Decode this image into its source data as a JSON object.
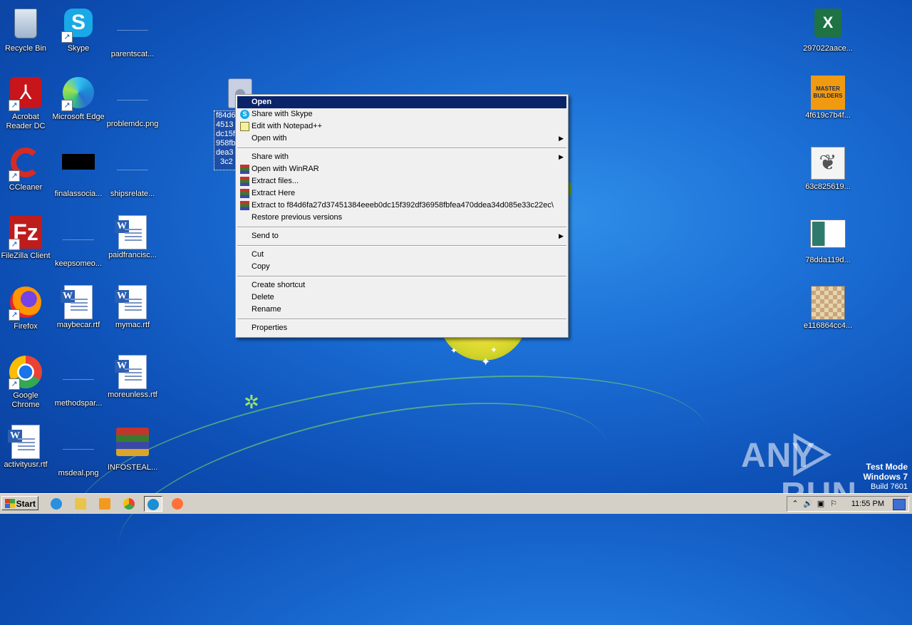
{
  "desktop": {
    "icons_left": [
      {
        "label": "Recycle Bin",
        "icon": "recycle-bin-icon",
        "shortcut": false
      },
      {
        "label": "Skype",
        "icon": "skype-icon",
        "shortcut": true
      },
      {
        "label": "parentscat...",
        "icon": "blank-file-icon",
        "shortcut": false
      },
      {
        "label": "Acrobat Reader DC",
        "icon": "acrobat-icon",
        "shortcut": true
      },
      {
        "label": "Microsoft Edge",
        "icon": "edge-icon",
        "shortcut": true
      },
      {
        "label": "problemdc.png",
        "icon": "blank-file-icon",
        "shortcut": false
      },
      {
        "label": "CCleaner",
        "icon": "ccleaner-icon",
        "shortcut": true
      },
      {
        "label": "finalassocia...",
        "icon": "black-file-icon",
        "shortcut": false
      },
      {
        "label": "shipsrelate...",
        "icon": "blank-file-icon",
        "shortcut": false
      },
      {
        "label": "FileZilla Client",
        "icon": "filezilla-icon",
        "shortcut": true
      },
      {
        "label": "keepsomeo...",
        "icon": "blank-file-icon",
        "shortcut": false
      },
      {
        "label": "paidfrancisc...",
        "icon": "word-doc-icon",
        "shortcut": false
      },
      {
        "label": "Firefox",
        "icon": "firefox-icon",
        "shortcut": true
      },
      {
        "label": "maybecar.rtf",
        "icon": "word-doc-icon",
        "shortcut": false
      },
      {
        "label": "mymac.rtf",
        "icon": "word-doc-icon",
        "shortcut": false
      },
      {
        "label": "Google Chrome",
        "icon": "chrome-icon",
        "shortcut": true
      },
      {
        "label": "methodspar...",
        "icon": "blank-file-icon",
        "shortcut": false
      },
      {
        "label": "moreunless.rtf",
        "icon": "word-doc-icon",
        "shortcut": false
      },
      {
        "label": "activityusr.rtf",
        "icon": "word-doc-icon",
        "shortcut": false
      },
      {
        "label": "msdeal.png",
        "icon": "blank-file-icon",
        "shortcut": false
      },
      {
        "label": "INFOSTEAL...",
        "icon": "winrar-icon",
        "shortcut": false
      }
    ],
    "icons_right": [
      {
        "label": "297022aace...",
        "icon": "excel-icon"
      },
      {
        "label": "4f619c7b4f...",
        "icon": "master-builders-icon"
      },
      {
        "label": "63c825619...",
        "icon": "gimp-icon"
      },
      {
        "label": "78dda119d...",
        "icon": "image-file-icon"
      },
      {
        "label": "e116864cc4...",
        "icon": "photo-file-icon"
      }
    ],
    "selected_file_lines": [
      "f84d6",
      "4513",
      "dc15f",
      "958fb",
      "dea3",
      "3c2"
    ],
    "master_builders_text": "MASTER BUILDERS"
  },
  "context_menu": {
    "items": [
      {
        "label": "Open",
        "highlight": true
      },
      {
        "label": "Share with Skype",
        "icon": "skype-icon"
      },
      {
        "label": "Edit with Notepad++",
        "icon": "notepad-plus-icon"
      },
      {
        "label": "Open with",
        "submenu": true
      },
      {
        "separator": true
      },
      {
        "label": "Share with",
        "submenu": true
      },
      {
        "label": "Open with WinRAR",
        "icon": "winrar-icon"
      },
      {
        "label": "Extract files...",
        "icon": "winrar-icon"
      },
      {
        "label": "Extract Here",
        "icon": "winrar-icon"
      },
      {
        "label": "Extract to f84d6fa27d37451384eeeb0dc15f392df36958fbfea470ddea34d085e33c22ec\\",
        "icon": "winrar-icon"
      },
      {
        "label": "Restore previous versions"
      },
      {
        "separator": true
      },
      {
        "label": "Send to",
        "submenu": true
      },
      {
        "separator": true
      },
      {
        "label": "Cut"
      },
      {
        "label": "Copy"
      },
      {
        "separator": true
      },
      {
        "label": "Create shortcut"
      },
      {
        "label": "Delete"
      },
      {
        "label": "Rename"
      },
      {
        "separator": true
      },
      {
        "label": "Properties"
      }
    ]
  },
  "taskbar": {
    "start_label": "Start",
    "apps": [
      "ie-icon",
      "explorer-icon",
      "media-player-icon",
      "chrome-icon",
      "edge-icon",
      "firefox-icon"
    ],
    "clock": "11:55 PM"
  },
  "watermark": {
    "left": "ANY",
    "right": "RUN"
  },
  "test_mode": {
    "line1": "Test Mode",
    "line2": "Windows 7",
    "line3": "Build 7601"
  }
}
